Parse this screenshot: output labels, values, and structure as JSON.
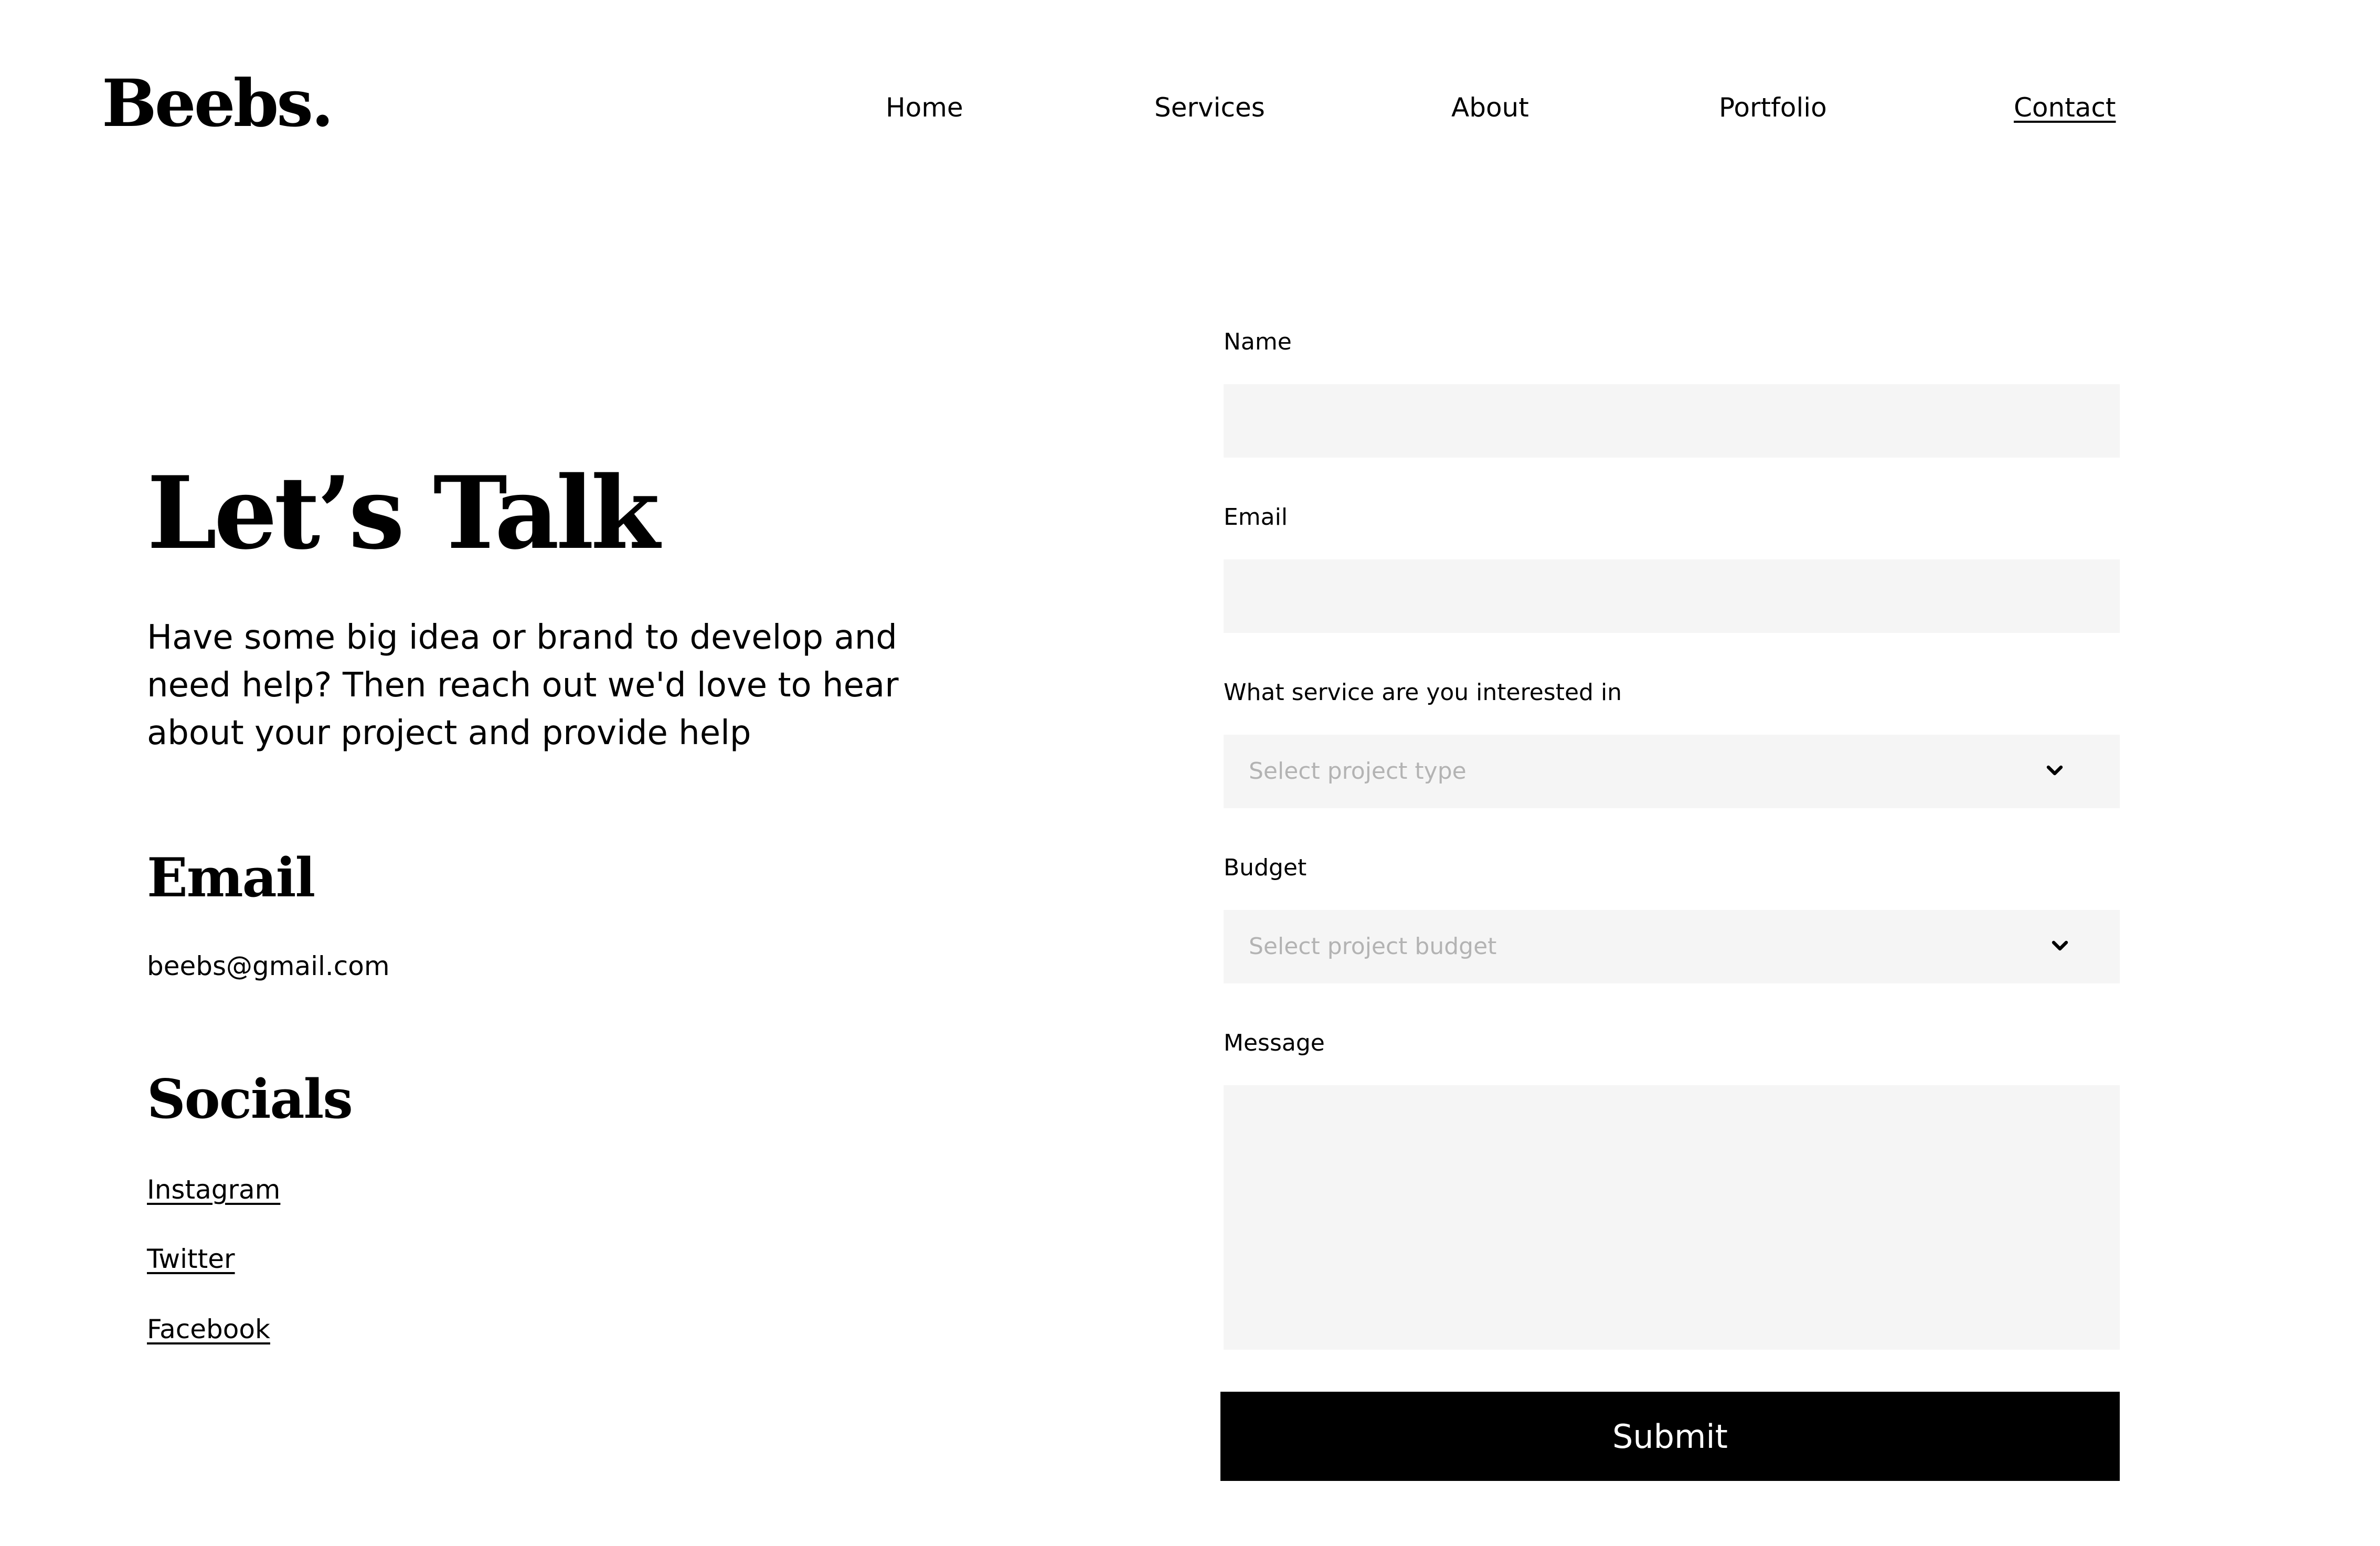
{
  "brand": {
    "logo_text": "Beebs."
  },
  "nav": {
    "items": [
      {
        "label": "Home"
      },
      {
        "label": "Services"
      },
      {
        "label": "About"
      },
      {
        "label": "Portfolio"
      },
      {
        "label": "Contact",
        "active": true
      }
    ]
  },
  "hero": {
    "title": "Let’s Talk",
    "text": "Have some big idea or brand to develop and need help? Then reach out we'd love to hear about your project  and provide help"
  },
  "email_section": {
    "title": "Email",
    "value": "beebs@gmail.com"
  },
  "socials_section": {
    "title": "Socials",
    "links": [
      {
        "label": "Instagram"
      },
      {
        "label": "Twitter"
      },
      {
        "label": "Facebook"
      }
    ]
  },
  "form": {
    "name_label": "Name",
    "name_value": "",
    "email_label": "Email",
    "email_value": "",
    "service_label": "What service are you interested in",
    "service_placeholder": "Select project type",
    "budget_label": "Budget",
    "budget_placeholder": "Select project budget",
    "message_label": "Message",
    "message_value": "",
    "submit_label": "Submit"
  },
  "colors": {
    "background": "#ffffff",
    "text": "#000000",
    "field_background": "#f5f5f5",
    "placeholder": "#b3b3b3",
    "button_background": "#000000",
    "button_text": "#ffffff"
  },
  "icons": {
    "select_arrow": "chevron-down-icon"
  }
}
